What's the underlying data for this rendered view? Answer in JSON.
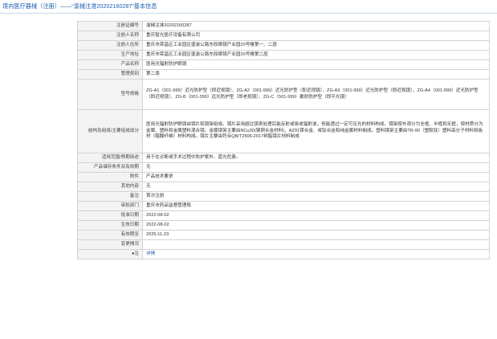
{
  "header": {
    "title": "境内医疗器械（注册）——“渝械注准20202160287”基本信息"
  },
  "rows": [
    {
      "label": "注册证编号",
      "value": "渝械注准20202160287"
    },
    {
      "label": "注册人名称",
      "value": "重庆智光医疗设备有限公司"
    },
    {
      "label": "注册人住所",
      "value": "重庆市荣昌区工业园区盛渝公路东段眼镜产业园20号楼第一、二层"
    },
    {
      "label": "生产地址",
      "value": "重庆市荣昌区工业园区盛渝公路东段眼镜产业园20号楼第二层"
    },
    {
      "label": "产品名称",
      "value": "医用光辐射防护眼镜"
    },
    {
      "label": "管理类别",
      "value": "第二类"
    },
    {
      "label": "型号规格",
      "value": "ZG-A1（001-999）近光防护型（即近视镜）、ZG-A2（001-999）近光防护型（即近视镜）、ZG-A3（001-999）近光防护型（即近视镜）、ZG-A4（001-999）近光防护型（即近视镜）、ZG-B（001-399）远光防护型（即老视镜）、ZG-C（501-999）散射防护型（即平光镜）"
    },
    {
      "label": "结构及组成/主要组成成分",
      "value": "医用光辐射防护眼镜由镜片和镜架组成。镜片采用超过镜表处理后能反射或吸收辐射波，但能透过一定可见光的材料构成。镜架按外观分为全框、半框和无框，按材质分为金属、塑料和金属塑料混合镜。金属镜架主要由NCu30(镍铜合金材料)、AZ91镁合金、或钛合金和纯金属材料制成。塑料镜架主要由TR-90（塑胶钛）塑料高分子材料和板材（醋酸纤维）材料构成。镜片主要由符合QB/T2506-2017树脂镜片材料制成"
    },
    {
      "label": "适用范围/预期用途",
      "value": "用于在诊断或手术过程中防护紫外、蓝光危害。"
    },
    {
      "label": "产品储存条件及有效期",
      "value": "无"
    },
    {
      "label": "附件",
      "value": "产品技术要求"
    },
    {
      "label": "其他内容",
      "value": "无"
    },
    {
      "label": "备注",
      "value": "首次注册"
    },
    {
      "label": "审批部门",
      "value": "重庆市药品监督管理局"
    },
    {
      "label": "批准日期",
      "value": "2022-08-02"
    },
    {
      "label": "生效日期",
      "value": "2022-08-02"
    },
    {
      "label": "有效期至",
      "value": "2025-11-23"
    },
    {
      "label": "变更情况",
      "value": ""
    },
    {
      "label": "●注",
      "value": "详情",
      "link": true
    }
  ]
}
